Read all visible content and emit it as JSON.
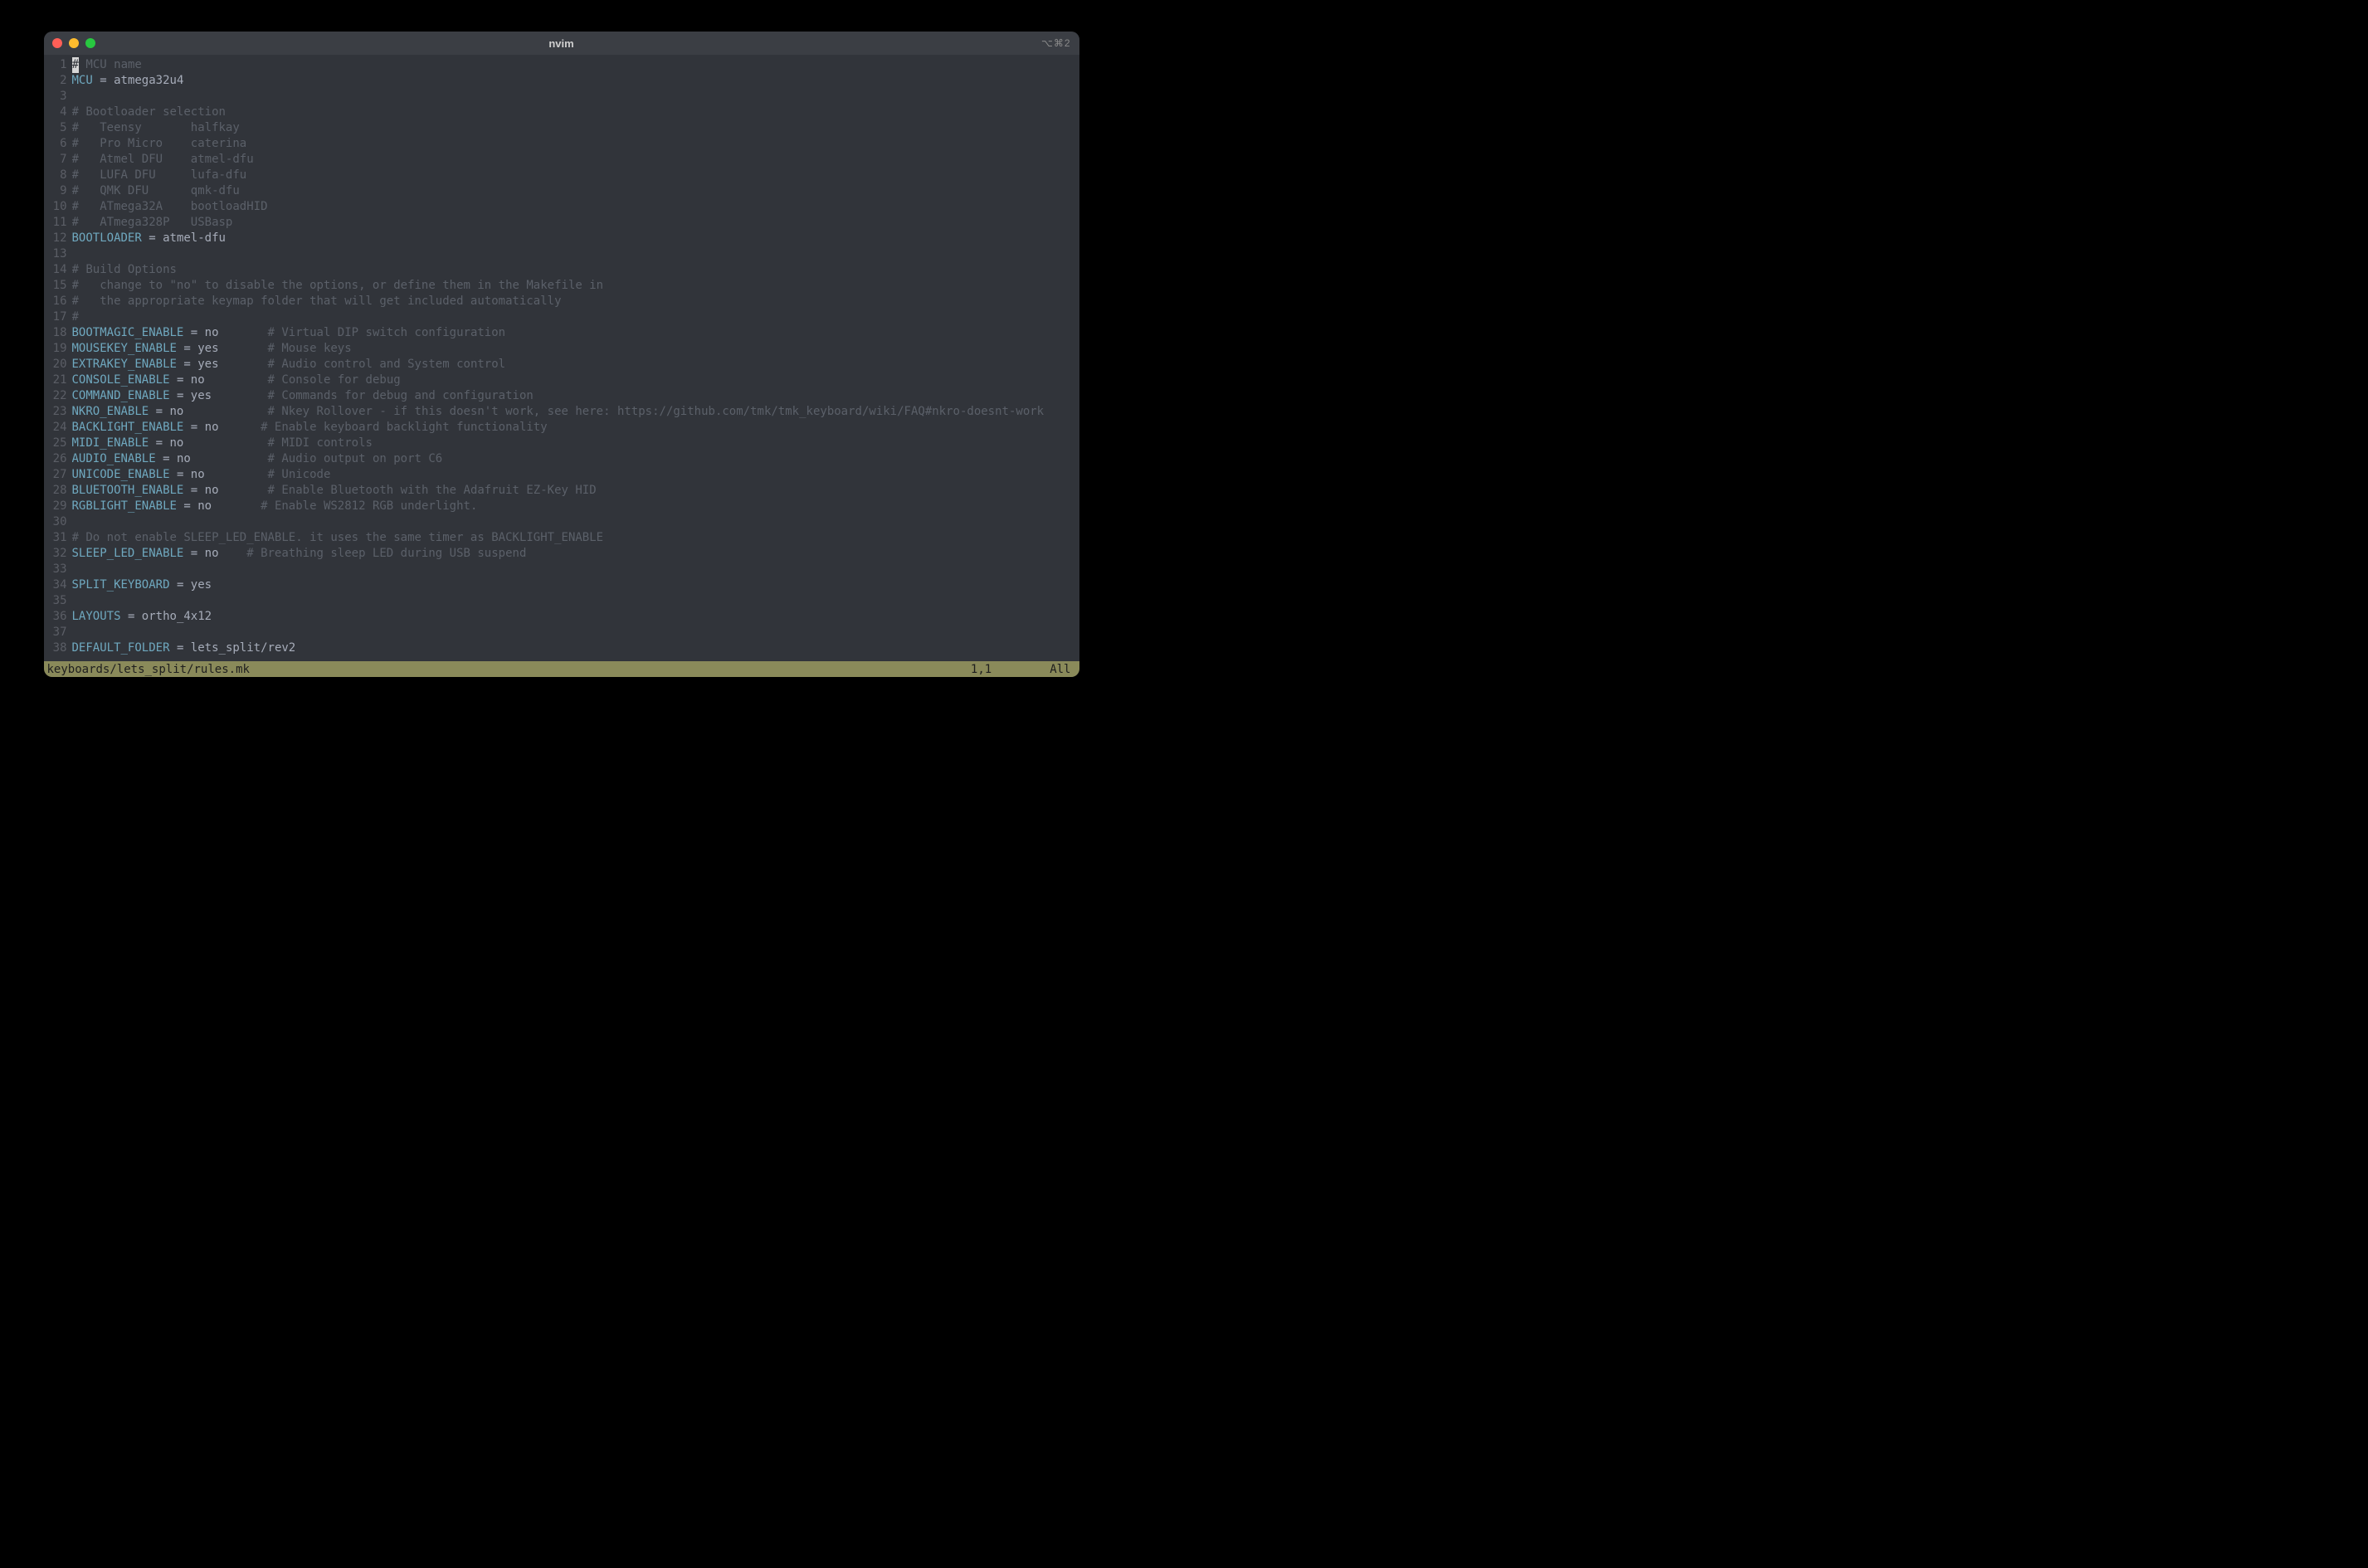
{
  "window": {
    "title": "nvim",
    "shortcut": "⌥⌘2"
  },
  "statusbar": {
    "filepath": "keyboards/lets_split/rules.mk",
    "position": "1,1",
    "scroll": "All"
  },
  "editor": {
    "lines": [
      {
        "num": "1",
        "cursor": "#",
        "segs": [
          {
            "t": " MCU name",
            "c": "comment"
          }
        ]
      },
      {
        "num": "2",
        "segs": [
          {
            "t": "MCU",
            "c": "ident"
          },
          {
            "t": " = atmega32u4",
            "c": "plain"
          }
        ]
      },
      {
        "num": "3",
        "segs": []
      },
      {
        "num": "4",
        "segs": [
          {
            "t": "# Bootloader selection",
            "c": "comment"
          }
        ]
      },
      {
        "num": "5",
        "segs": [
          {
            "t": "#   Teensy       halfkay",
            "c": "comment"
          }
        ]
      },
      {
        "num": "6",
        "segs": [
          {
            "t": "#   Pro Micro    caterina",
            "c": "comment"
          }
        ]
      },
      {
        "num": "7",
        "segs": [
          {
            "t": "#   Atmel DFU    atmel-dfu",
            "c": "comment"
          }
        ]
      },
      {
        "num": "8",
        "segs": [
          {
            "t": "#   LUFA DFU     lufa-dfu",
            "c": "comment"
          }
        ]
      },
      {
        "num": "9",
        "segs": [
          {
            "t": "#   QMK DFU      qmk-dfu",
            "c": "comment"
          }
        ]
      },
      {
        "num": "10",
        "segs": [
          {
            "t": "#   ATmega32A    bootloadHID",
            "c": "comment"
          }
        ]
      },
      {
        "num": "11",
        "segs": [
          {
            "t": "#   ATmega328P   USBasp",
            "c": "comment"
          }
        ]
      },
      {
        "num": "12",
        "segs": [
          {
            "t": "BOOTLOADER",
            "c": "ident"
          },
          {
            "t": " = atmel-dfu",
            "c": "plain"
          }
        ]
      },
      {
        "num": "13",
        "segs": []
      },
      {
        "num": "14",
        "segs": [
          {
            "t": "# Build Options",
            "c": "comment"
          }
        ]
      },
      {
        "num": "15",
        "segs": [
          {
            "t": "#   change to \"no\" to disable the options, or define them in the Makefile in",
            "c": "comment"
          }
        ]
      },
      {
        "num": "16",
        "segs": [
          {
            "t": "#   the appropriate keymap folder that will get included automatically",
            "c": "comment"
          }
        ]
      },
      {
        "num": "17",
        "segs": [
          {
            "t": "#",
            "c": "comment"
          }
        ]
      },
      {
        "num": "18",
        "segs": [
          {
            "t": "BOOTMAGIC_ENABLE",
            "c": "ident"
          },
          {
            "t": " = no       ",
            "c": "plain"
          },
          {
            "t": "# Virtual DIP switch configuration",
            "c": "comment"
          }
        ]
      },
      {
        "num": "19",
        "segs": [
          {
            "t": "MOUSEKEY_ENABLE",
            "c": "ident"
          },
          {
            "t": " = yes       ",
            "c": "plain"
          },
          {
            "t": "# Mouse keys",
            "c": "comment"
          }
        ]
      },
      {
        "num": "20",
        "segs": [
          {
            "t": "EXTRAKEY_ENABLE",
            "c": "ident"
          },
          {
            "t": " = yes       ",
            "c": "plain"
          },
          {
            "t": "# Audio control and System control",
            "c": "comment"
          }
        ]
      },
      {
        "num": "21",
        "segs": [
          {
            "t": "CONSOLE_ENABLE",
            "c": "ident"
          },
          {
            "t": " = no         ",
            "c": "plain"
          },
          {
            "t": "# Console for debug",
            "c": "comment"
          }
        ]
      },
      {
        "num": "22",
        "segs": [
          {
            "t": "COMMAND_ENABLE",
            "c": "ident"
          },
          {
            "t": " = yes        ",
            "c": "plain"
          },
          {
            "t": "# Commands for debug and configuration",
            "c": "comment"
          }
        ]
      },
      {
        "num": "23",
        "segs": [
          {
            "t": "NKRO_ENABLE",
            "c": "ident"
          },
          {
            "t": " = no            ",
            "c": "plain"
          },
          {
            "t": "# Nkey Rollover - if this doesn't work, see here: https://github.com/tmk/tmk_keyboard/wiki/FAQ#nkro-doesnt-work",
            "c": "comment"
          }
        ]
      },
      {
        "num": "24",
        "segs": [
          {
            "t": "BACKLIGHT_ENABLE",
            "c": "ident"
          },
          {
            "t": " = no      ",
            "c": "plain"
          },
          {
            "t": "# Enable keyboard backlight functionality",
            "c": "comment"
          }
        ]
      },
      {
        "num": "25",
        "segs": [
          {
            "t": "MIDI_ENABLE",
            "c": "ident"
          },
          {
            "t": " = no            ",
            "c": "plain"
          },
          {
            "t": "# MIDI controls",
            "c": "comment"
          }
        ]
      },
      {
        "num": "26",
        "segs": [
          {
            "t": "AUDIO_ENABLE",
            "c": "ident"
          },
          {
            "t": " = no           ",
            "c": "plain"
          },
          {
            "t": "# Audio output on port C6",
            "c": "comment"
          }
        ]
      },
      {
        "num": "27",
        "segs": [
          {
            "t": "UNICODE_ENABLE",
            "c": "ident"
          },
          {
            "t": " = no         ",
            "c": "plain"
          },
          {
            "t": "# Unicode",
            "c": "comment"
          }
        ]
      },
      {
        "num": "28",
        "segs": [
          {
            "t": "BLUETOOTH_ENABLE",
            "c": "ident"
          },
          {
            "t": " = no       ",
            "c": "plain"
          },
          {
            "t": "# Enable Bluetooth with the Adafruit EZ-Key HID",
            "c": "comment"
          }
        ]
      },
      {
        "num": "29",
        "segs": [
          {
            "t": "RGBLIGHT_ENABLE",
            "c": "ident"
          },
          {
            "t": " = no       ",
            "c": "plain"
          },
          {
            "t": "# Enable WS2812 RGB underlight.",
            "c": "comment"
          }
        ]
      },
      {
        "num": "30",
        "segs": []
      },
      {
        "num": "31",
        "segs": [
          {
            "t": "# Do not enable SLEEP_LED_ENABLE. it uses the same timer as BACKLIGHT_ENABLE",
            "c": "comment"
          }
        ]
      },
      {
        "num": "32",
        "segs": [
          {
            "t": "SLEEP_LED_ENABLE",
            "c": "ident"
          },
          {
            "t": " = no    ",
            "c": "plain"
          },
          {
            "t": "# Breathing sleep LED during USB suspend",
            "c": "comment"
          }
        ]
      },
      {
        "num": "33",
        "segs": []
      },
      {
        "num": "34",
        "segs": [
          {
            "t": "SPLIT_KEYBOARD",
            "c": "ident"
          },
          {
            "t": " = yes",
            "c": "plain"
          }
        ]
      },
      {
        "num": "35",
        "segs": []
      },
      {
        "num": "36",
        "segs": [
          {
            "t": "LAYOUTS",
            "c": "ident"
          },
          {
            "t": " = ortho_4x12",
            "c": "plain"
          }
        ]
      },
      {
        "num": "37",
        "segs": []
      },
      {
        "num": "38",
        "segs": [
          {
            "t": "DEFAULT_FOLDER",
            "c": "ident"
          },
          {
            "t": " = lets_split/rev2",
            "c": "plain"
          }
        ]
      }
    ]
  }
}
